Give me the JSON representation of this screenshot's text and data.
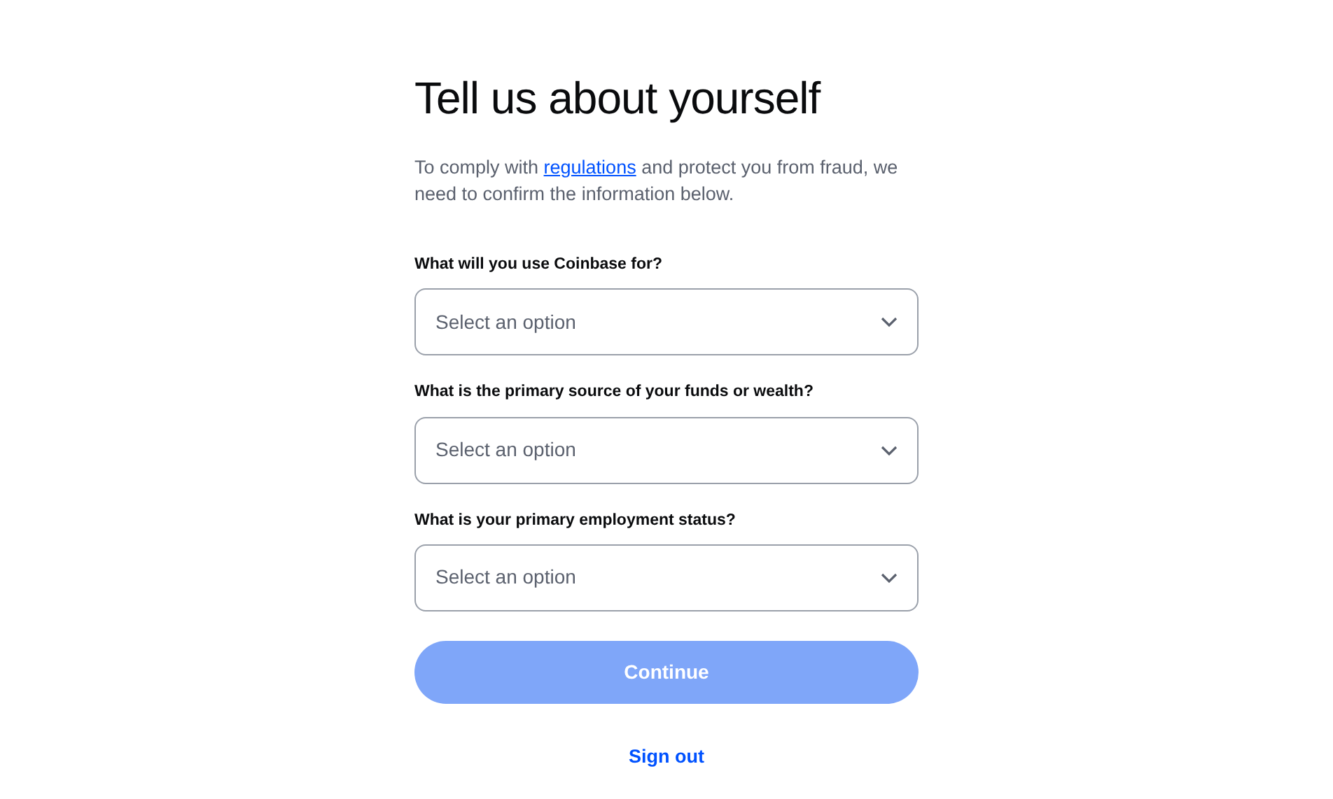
{
  "title": "Tell us about yourself",
  "intro": {
    "before": "To comply with ",
    "link": "regulations",
    "after": " and protect you from fraud, we need to confirm the information below."
  },
  "questions": [
    {
      "label": "What will you use Coinbase for?",
      "placeholder": "Select an option"
    },
    {
      "label": "What is the primary source of your funds or wealth?",
      "placeholder": "Select an option"
    },
    {
      "label": "What is your primary employment status?",
      "placeholder": "Select an option"
    }
  ],
  "continue_button": {
    "label": "Continue",
    "disabled": true
  },
  "sign_out": "Sign out"
}
